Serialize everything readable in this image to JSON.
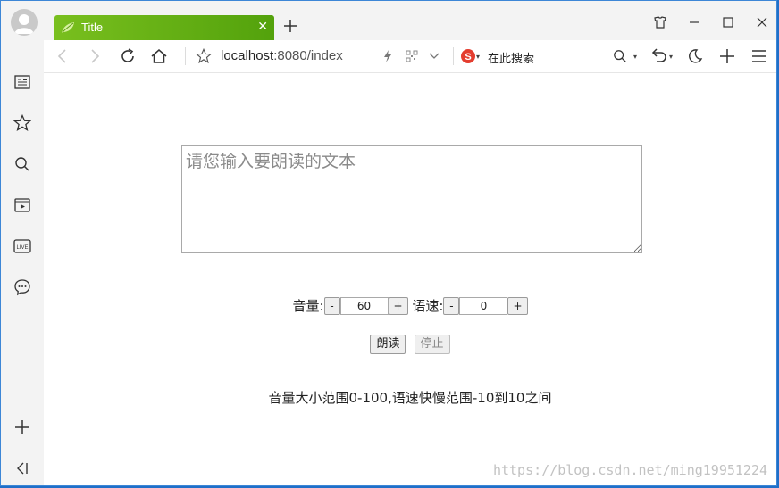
{
  "tab": {
    "title": "Title"
  },
  "address": {
    "host": "localhost",
    "path": ":8080/index"
  },
  "search": {
    "label": "在此搜索"
  },
  "form": {
    "textarea_placeholder": "请您输入要朗读的文本",
    "volume_label": "音量:",
    "volume_value": "60",
    "rate_label": "语速:",
    "rate_value": "0",
    "minus": "-",
    "plus": "+",
    "read_button": "朗读",
    "stop_button": "停止",
    "hint": "音量大小范围0-100,语速快慢范围-10到10之间"
  },
  "watermark": "https://blog.csdn.net/ming19951224",
  "colors": {
    "tab_green": "#6cb416",
    "accent_blue": "#1f6fc8"
  },
  "icons": {
    "sidebar": [
      "news-icon",
      "star-icon",
      "search-icon",
      "video-icon",
      "live-icon",
      "chat-icon",
      "add-icon",
      "collapse-icon"
    ],
    "toolbar": [
      "back-icon",
      "forward-icon",
      "reload-icon",
      "home-icon",
      "bookmark-star-icon",
      "lightning-icon",
      "qrcode-icon",
      "chevron-down-icon",
      "sogou-icon",
      "search-icon",
      "undo-icon",
      "moon-icon",
      "plus-icon",
      "menu-icon"
    ],
    "window": [
      "skin-icon",
      "minimize-icon",
      "maximize-icon",
      "close-icon"
    ]
  }
}
